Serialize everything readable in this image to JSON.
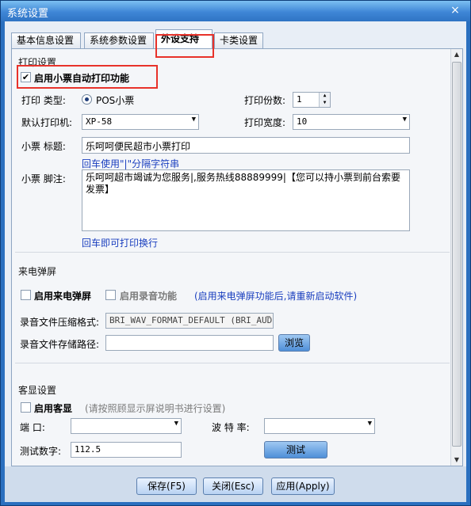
{
  "window": {
    "title": "系统设置",
    "close": "×"
  },
  "tabs": [
    {
      "label": "基本信息设置",
      "active": false
    },
    {
      "label": "系统参数设置",
      "active": false
    },
    {
      "label": "外设支持",
      "active": true
    },
    {
      "label": "卡类设置",
      "active": false
    }
  ],
  "print": {
    "section_title": "打印设置",
    "auto_print_label": "启用小票自动打印功能",
    "auto_print_checked": true,
    "type_label": "打印  类型:",
    "type_option": "POS小票",
    "copies_label": "打印份数:",
    "copies_value": "1",
    "printer_label": "默认打印机:",
    "printer_value": "XP-58",
    "width_label": "打印宽度:",
    "width_value": "10",
    "title_label": "小票  标题:",
    "title_value": "乐呵呵便民超市小票打印",
    "title_hint": "回车使用\"|\"分隔字符串",
    "footer_label": "小票  脚注:",
    "footer_value": "乐呵呵超市竭诚为您服务|,服务热线88889999|【您可以持小票到前台索要发票】",
    "footer_hint": "回车即可打印换行"
  },
  "callpop": {
    "section_title": "来电弹屏",
    "enable_label": "启用来电弹屏",
    "record_label": "启用录音功能",
    "note": "(启用来电弹屏功能后,请重新启动软件)",
    "format_label": "录音文件压缩格式:",
    "format_value": "BRI_WAV_FORMAT_DEFAULT (BRI_AUDI",
    "path_label": "录音文件存储路径:",
    "path_value": "",
    "browse_label": "浏览"
  },
  "display": {
    "section_title": "客显设置",
    "enable_label": "启用客显",
    "note": "(请按照顾显示屏说明书进行设置)",
    "port_label": "端    口:",
    "port_value": "",
    "baud_label": "波 特 率:",
    "baud_value": "",
    "test_label": "测试数字:",
    "test_value": "112.5",
    "test_button": "测试"
  },
  "footer": {
    "save": "保存(F5)",
    "close": "关闭(Esc)",
    "apply": "应用(Apply)"
  },
  "colors": {
    "highlight": "#e8322a",
    "accent_blue": "#1a3fbf"
  }
}
